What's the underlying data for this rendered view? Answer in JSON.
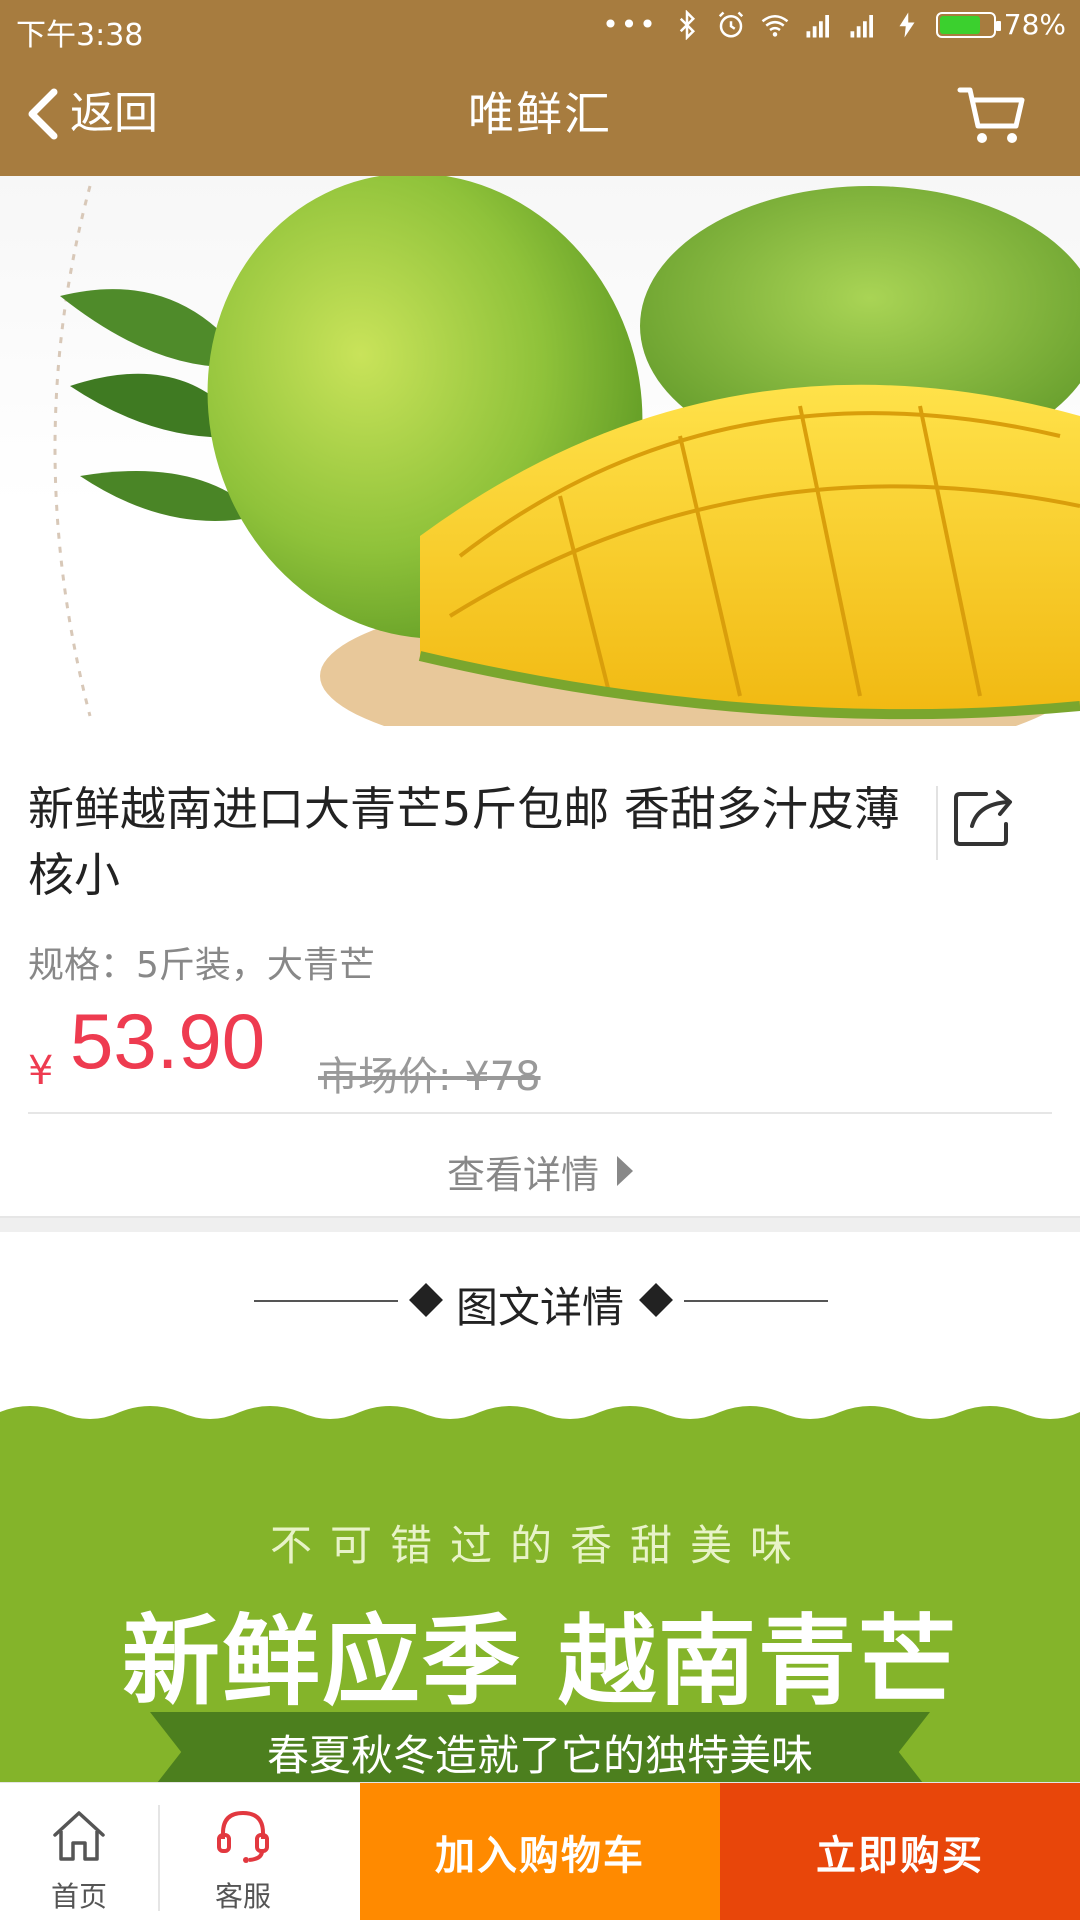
{
  "status_bar": {
    "time": "下午3:38",
    "battery": "78%",
    "battery_level": 0.78,
    "icons": [
      "more-dots-icon",
      "bluetooth-icon",
      "alarm-icon",
      "wifi-icon",
      "signal-icon",
      "signal-icon",
      "charging-icon",
      "battery-icon"
    ]
  },
  "header": {
    "back_label": "返回",
    "title": "唯鲜汇",
    "cart_icon": "cart-icon",
    "color": "#a77c3f"
  },
  "hero": {
    "icon": "mango-product-image"
  },
  "product": {
    "name": "新鲜越南进口大青芒5斤包邮 香甜多汁皮薄核小",
    "spec": "规格：5斤装，大青芒",
    "currency": "¥",
    "price": "53.90",
    "market_price": "市场价: ¥78",
    "details_link": "查看详情",
    "price_color": "#ee3b50"
  },
  "section": {
    "title": "图文详情"
  },
  "banner": {
    "subtitle": "不可错过的香甜美味",
    "headline": "新鲜应季 越南青芒",
    "ribbon": "春夏秋冬造就了它的独特美味",
    "color": "#84b42a"
  },
  "bottom_bar": {
    "home_label": "首页",
    "service_label": "客服",
    "add_to_cart": "加入购物车",
    "buy_now": "立即购买",
    "add_color": "#ff8a00",
    "buy_color": "#e8460a"
  }
}
